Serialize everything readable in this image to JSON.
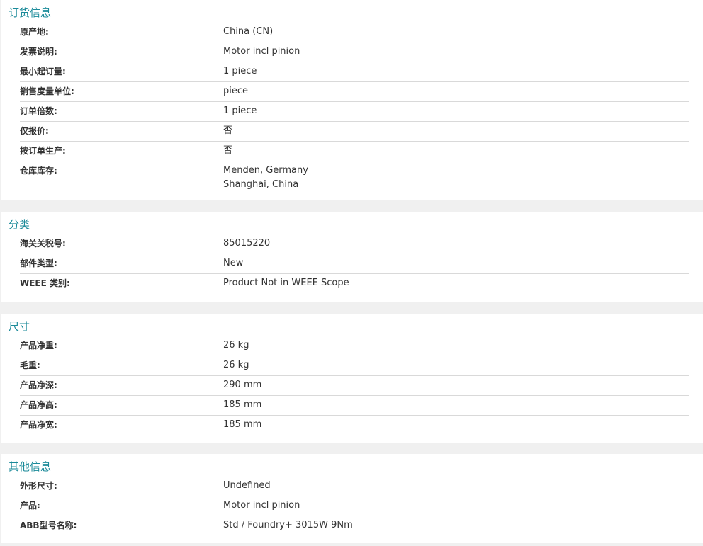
{
  "sections": [
    {
      "title": "订货信息",
      "rows": [
        {
          "label": "原产地:",
          "value": "China (CN)"
        },
        {
          "label": "发票说明:",
          "value": "Motor incl pinion"
        },
        {
          "label": "最小起订量:",
          "value": "1 piece"
        },
        {
          "label": "销售度量单位:",
          "value": "piece"
        },
        {
          "label": "订单倍数:",
          "value": "1 piece"
        },
        {
          "label": "仅报价:",
          "value": "否"
        },
        {
          "label": "按订单生产:",
          "value": "否"
        },
        {
          "label": "仓库库存:",
          "value_lines": [
            "Menden, Germany",
            "Shanghai, China"
          ]
        }
      ]
    },
    {
      "title": "分类",
      "rows": [
        {
          "label": "海关关税号:",
          "value": "85015220"
        },
        {
          "label": "部件类型:",
          "value": "New"
        },
        {
          "label": "WEEE 类别:",
          "value": "Product Not in WEEE Scope"
        }
      ]
    },
    {
      "title": "尺寸",
      "rows": [
        {
          "label": "产品净重:",
          "value": "26 kg"
        },
        {
          "label": "毛重:",
          "value": "26 kg"
        },
        {
          "label": "产品净深:",
          "value": "290 mm"
        },
        {
          "label": "产品净高:",
          "value": "185 mm"
        },
        {
          "label": "产品净宽:",
          "value": "185 mm"
        }
      ]
    },
    {
      "title": "其他信息",
      "rows": [
        {
          "label": "外形尺寸:",
          "value": "Undefined"
        },
        {
          "label": "产品:",
          "value": "Motor incl pinion"
        },
        {
          "label": "ABB型号名称:",
          "value": "Std / Foundry+ 3015W 9Nm"
        }
      ]
    }
  ]
}
